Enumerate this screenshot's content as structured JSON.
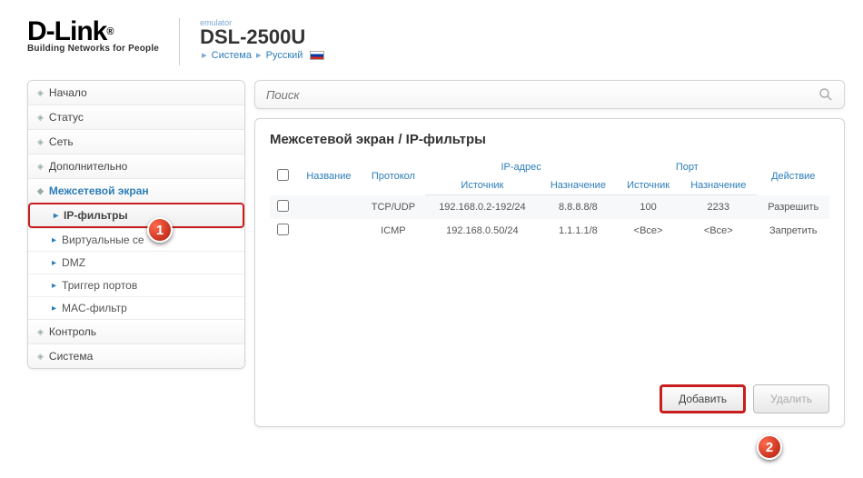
{
  "header": {
    "brand": "D-Link",
    "reg": "®",
    "tagline": "Building Networks for People",
    "emulator": "emulator",
    "model": "DSL-2500U",
    "crumb_system": "Система",
    "crumb_lang": "Русский"
  },
  "search": {
    "placeholder": "Поиск"
  },
  "sidebar": {
    "items": [
      {
        "label": "Начало"
      },
      {
        "label": "Статус"
      },
      {
        "label": "Сеть"
      },
      {
        "label": "Дополнительно"
      },
      {
        "label": "Межсетевой экран"
      },
      {
        "label": "Контроль"
      },
      {
        "label": "Система"
      }
    ],
    "firewall_children": [
      {
        "label": "IP-фильтры"
      },
      {
        "label": "Виртуальные се"
      },
      {
        "label": "DMZ"
      },
      {
        "label": "Триггер портов"
      },
      {
        "label": "MAC-фильтр"
      }
    ]
  },
  "panel": {
    "title": "Межсетевой экран /  IP-фильтры",
    "headers": {
      "name": "Название",
      "proto": "Протокол",
      "ip_group": "IP-адрес",
      "src": "Источник",
      "dst": "Назначение",
      "port_group": "Порт",
      "psrc": "Источник",
      "pdst": "Назначение",
      "action": "Действие"
    },
    "rows": [
      {
        "name": "",
        "proto": "TCP/UDP",
        "src": "192.168.0.2-192/24",
        "dst": "8.8.8.8/8",
        "psrc": "100",
        "pdst": "2233",
        "action": "Разрешить"
      },
      {
        "name": "",
        "proto": "ICMP",
        "src": "192.168.0.50/24",
        "dst": "1.1.1.1/8",
        "psrc": "<Все>",
        "pdst": "<Все>",
        "action": "Запретить"
      }
    ],
    "buttons": {
      "add": "Добавить",
      "del": "Удалить"
    }
  },
  "annotations": {
    "a1": "1",
    "a2": "2"
  }
}
